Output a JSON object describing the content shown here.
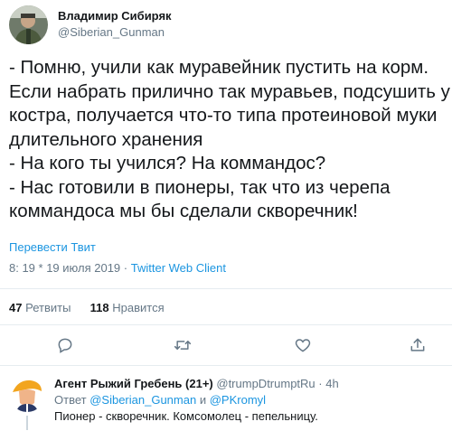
{
  "tweet": {
    "author": {
      "name": "Владимир Сибиряк",
      "handle": "@Siberian_Gunman"
    },
    "lines": [
      "- Помню, учили как муравейник пустить на корм.",
      "Если набрать прилично так муравьев, подсушить у",
      "костра, получается что-то типа протеиновой муки",
      "длительного хранения",
      "- На кого ты учился? На коммандос?",
      "- Нас готовили в пионеры, так что из черепа",
      "коммандоса мы бы сделали скворечник!"
    ],
    "translate_label": "Перевести Твит",
    "timestamp": "8: 19 * 19 июля 2019",
    "separator": "·",
    "client": "Twitter Web Client"
  },
  "stats": {
    "retweets_count": "47",
    "retweets_label": "Ретвиты",
    "likes_count": "118",
    "likes_label": "Нравится"
  },
  "actions": [
    {
      "name": "reply-icon"
    },
    {
      "name": "retweet-icon"
    },
    {
      "name": "like-icon"
    },
    {
      "name": "share-icon"
    }
  ],
  "reply": {
    "author_name": "Агент Рыжий Гребень (21+)",
    "handle": "@trumpDtrumptRu",
    "separator": "·",
    "time": "4h",
    "reply_to_prefix": "Ответ",
    "mention1": "@Siberian_Gunman",
    "conjunction": "и",
    "mention2": "@PKromyl",
    "text": "Пионер - скворечник. Комсомолец - пепельницу."
  },
  "colors": {
    "link": "#1b95e0",
    "secondary_text": "#657786",
    "primary_text": "#14171a",
    "divider": "#e6ecf0"
  }
}
